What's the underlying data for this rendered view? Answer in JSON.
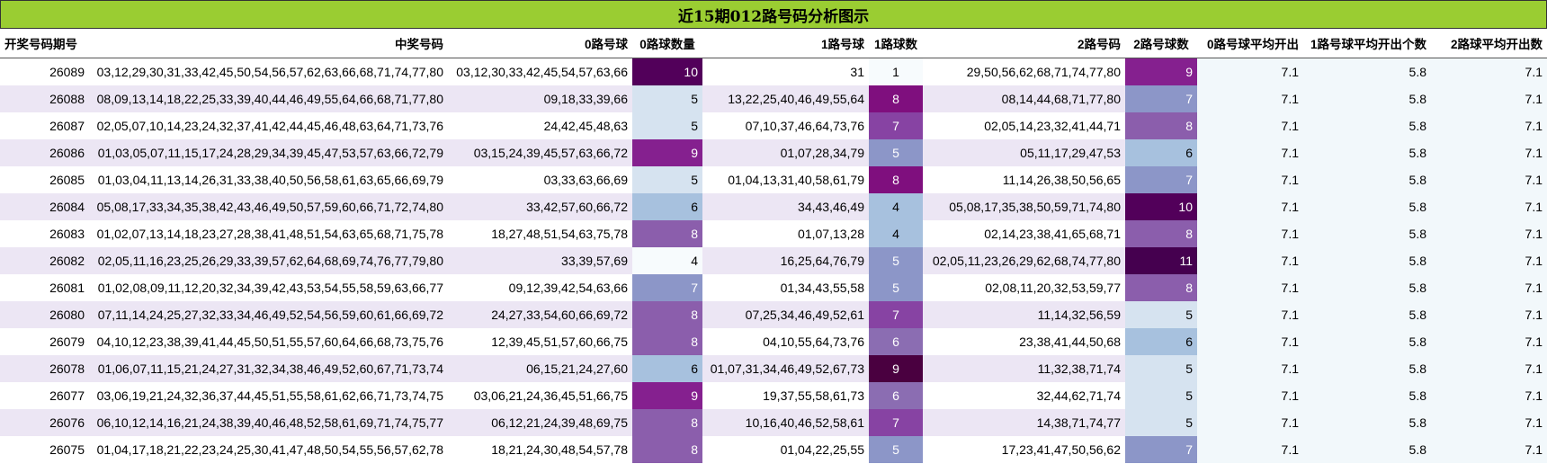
{
  "title": "近15期012路号码分析图示",
  "headers": [
    "开奖号码期号",
    "中奖号码",
    "0路号球",
    "0路球数量",
    "1路号球",
    "1路球数",
    "2路号码",
    "2路号球数",
    "0路号球平均开出",
    "1路号球平均开出个数",
    "2路球平均开出数"
  ],
  "colors": {
    "title_bg": "#9acd32",
    "row_even": "#ece6f4",
    "avg_bg": "#f2f8fb",
    "scale": {
      "4": "#f7fbfd",
      "5": "#d6e3f0",
      "6": "#a7c1de",
      "7": "#8c96c8",
      "8": "#8b5eac",
      "9": "#85208f",
      "10": "#52005a",
      "11": "#45004f"
    },
    "scale_1": {
      "1": "#f7fbfd",
      "4": "#a7c1de",
      "5": "#8c96c8",
      "6": "#8b6db2",
      "7": "#8743a3",
      "8": "#7f0f7e",
      "9": "#4a0040"
    }
  },
  "rows": [
    {
      "period": "26089",
      "numbers": "03,12,29,30,31,33,42,45,50,54,56,57,62,63,66,68,71,74,77,80",
      "r0": "03,12,30,33,42,45,54,57,63,66",
      "c0": "10",
      "r1": "31",
      "c1": "1",
      "r2": "29,50,56,62,68,71,74,77,80",
      "c2": "9",
      "a0": "7.1",
      "a1": "5.8",
      "a2": "7.1"
    },
    {
      "period": "26088",
      "numbers": "08,09,13,14,18,22,25,33,39,40,44,46,49,55,64,66,68,71,77,80",
      "r0": "09,18,33,39,66",
      "c0": "5",
      "r1": "13,22,25,40,46,49,55,64",
      "c1": "8",
      "r2": "08,14,44,68,71,77,80",
      "c2": "7",
      "a0": "7.1",
      "a1": "5.8",
      "a2": "7.1"
    },
    {
      "period": "26087",
      "numbers": "02,05,07,10,14,23,24,32,37,41,42,44,45,46,48,63,64,71,73,76",
      "r0": "24,42,45,48,63",
      "c0": "5",
      "r1": "07,10,37,46,64,73,76",
      "c1": "7",
      "r2": "02,05,14,23,32,41,44,71",
      "c2": "8",
      "a0": "7.1",
      "a1": "5.8",
      "a2": "7.1"
    },
    {
      "period": "26086",
      "numbers": "01,03,05,07,11,15,17,24,28,29,34,39,45,47,53,57,63,66,72,79",
      "r0": "03,15,24,39,45,57,63,66,72",
      "c0": "9",
      "r1": "01,07,28,34,79",
      "c1": "5",
      "r2": "05,11,17,29,47,53",
      "c2": "6",
      "a0": "7.1",
      "a1": "5.8",
      "a2": "7.1"
    },
    {
      "period": "26085",
      "numbers": "01,03,04,11,13,14,26,31,33,38,40,50,56,58,61,63,65,66,69,79",
      "r0": "03,33,63,66,69",
      "c0": "5",
      "r1": "01,04,13,31,40,58,61,79",
      "c1": "8",
      "r2": "11,14,26,38,50,56,65",
      "c2": "7",
      "a0": "7.1",
      "a1": "5.8",
      "a2": "7.1"
    },
    {
      "period": "26084",
      "numbers": "05,08,17,33,34,35,38,42,43,46,49,50,57,59,60,66,71,72,74,80",
      "r0": "33,42,57,60,66,72",
      "c0": "6",
      "r1": "34,43,46,49",
      "c1": "4",
      "r2": "05,08,17,35,38,50,59,71,74,80",
      "c2": "10",
      "a0": "7.1",
      "a1": "5.8",
      "a2": "7.1"
    },
    {
      "period": "26083",
      "numbers": "01,02,07,13,14,18,23,27,28,38,41,48,51,54,63,65,68,71,75,78",
      "r0": "18,27,48,51,54,63,75,78",
      "c0": "8",
      "r1": "01,07,13,28",
      "c1": "4",
      "r2": "02,14,23,38,41,65,68,71",
      "c2": "8",
      "a0": "7.1",
      "a1": "5.8",
      "a2": "7.1"
    },
    {
      "period": "26082",
      "numbers": "02,05,11,16,23,25,26,29,33,39,57,62,64,68,69,74,76,77,79,80",
      "r0": "33,39,57,69",
      "c0": "4",
      "r1": "16,25,64,76,79",
      "c1": "5",
      "r2": "02,05,11,23,26,29,62,68,74,77,80",
      "c2": "11",
      "a0": "7.1",
      "a1": "5.8",
      "a2": "7.1"
    },
    {
      "period": "26081",
      "numbers": "01,02,08,09,11,12,20,32,34,39,42,43,53,54,55,58,59,63,66,77",
      "r0": "09,12,39,42,54,63,66",
      "c0": "7",
      "r1": "01,34,43,55,58",
      "c1": "5",
      "r2": "02,08,11,20,32,53,59,77",
      "c2": "8",
      "a0": "7.1",
      "a1": "5.8",
      "a2": "7.1"
    },
    {
      "period": "26080",
      "numbers": "07,11,14,24,25,27,32,33,34,46,49,52,54,56,59,60,61,66,69,72",
      "r0": "24,27,33,54,60,66,69,72",
      "c0": "8",
      "r1": "07,25,34,46,49,52,61",
      "c1": "7",
      "r2": "11,14,32,56,59",
      "c2": "5",
      "a0": "7.1",
      "a1": "5.8",
      "a2": "7.1"
    },
    {
      "period": "26079",
      "numbers": "04,10,12,23,38,39,41,44,45,50,51,55,57,60,64,66,68,73,75,76",
      "r0": "12,39,45,51,57,60,66,75",
      "c0": "8",
      "r1": "04,10,55,64,73,76",
      "c1": "6",
      "r2": "23,38,41,44,50,68",
      "c2": "6",
      "a0": "7.1",
      "a1": "5.8",
      "a2": "7.1"
    },
    {
      "period": "26078",
      "numbers": "01,06,07,11,15,21,24,27,31,32,34,38,46,49,52,60,67,71,73,74",
      "r0": "06,15,21,24,27,60",
      "c0": "6",
      "r1": "01,07,31,34,46,49,52,67,73",
      "c1": "9",
      "r2": "11,32,38,71,74",
      "c2": "5",
      "a0": "7.1",
      "a1": "5.8",
      "a2": "7.1"
    },
    {
      "period": "26077",
      "numbers": "03,06,19,21,24,32,36,37,44,45,51,55,58,61,62,66,71,73,74,75",
      "r0": "03,06,21,24,36,45,51,66,75",
      "c0": "9",
      "r1": "19,37,55,58,61,73",
      "c1": "6",
      "r2": "32,44,62,71,74",
      "c2": "5",
      "a0": "7.1",
      "a1": "5.8",
      "a2": "7.1"
    },
    {
      "period": "26076",
      "numbers": "06,10,12,14,16,21,24,38,39,40,46,48,52,58,61,69,71,74,75,77",
      "r0": "06,12,21,24,39,48,69,75",
      "c0": "8",
      "r1": "10,16,40,46,52,58,61",
      "c1": "7",
      "r2": "14,38,71,74,77",
      "c2": "5",
      "a0": "7.1",
      "a1": "5.8",
      "a2": "7.1"
    },
    {
      "period": "26075",
      "numbers": "01,04,17,18,21,22,23,24,25,30,41,47,48,50,54,55,56,57,62,78",
      "r0": "18,21,24,30,48,54,57,78",
      "c0": "8",
      "r1": "01,04,22,25,55",
      "c1": "5",
      "r2": "17,23,41,47,50,56,62",
      "c2": "7",
      "a0": "7.1",
      "a1": "5.8",
      "a2": "7.1"
    }
  ]
}
